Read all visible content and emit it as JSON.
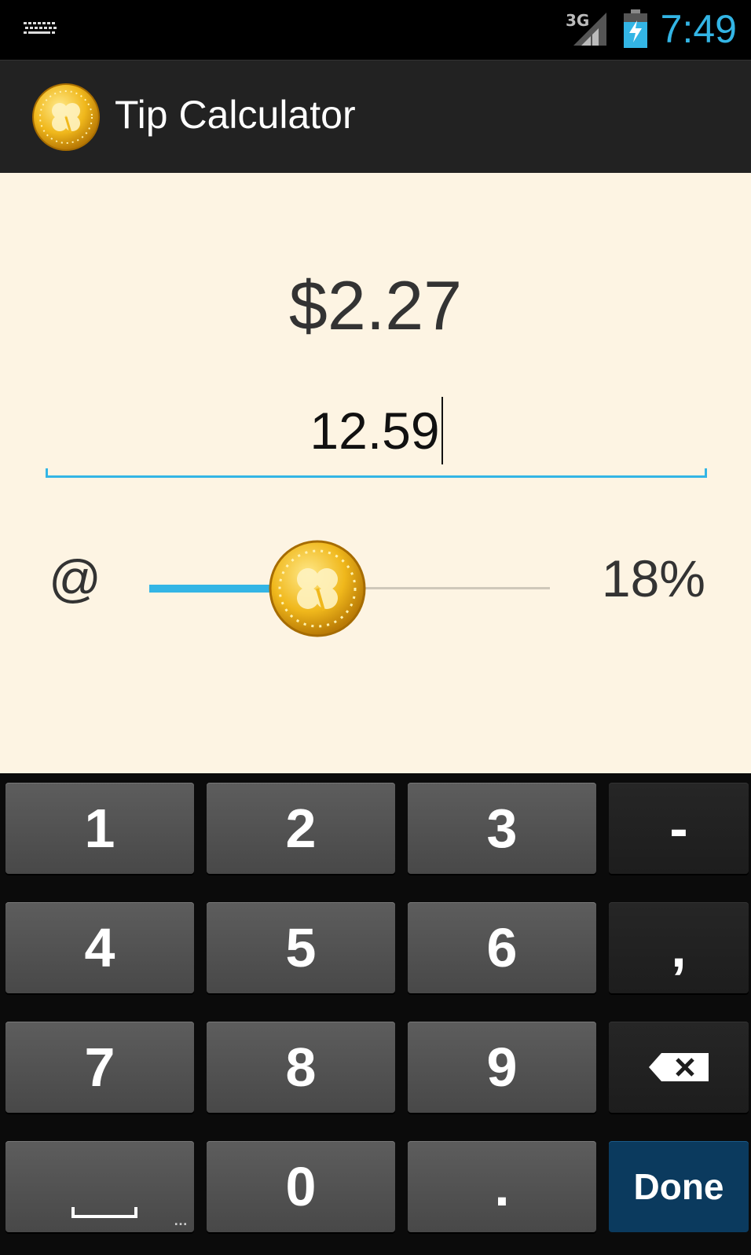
{
  "status_bar": {
    "network": "3G",
    "time": "7:49"
  },
  "action_bar": {
    "title": "Tip Calculator",
    "icon": "coin-clover-icon"
  },
  "main": {
    "tip_amount": "$2.27",
    "bill_amount": "12.59",
    "at_label": "@",
    "tip_percent_label": "18%",
    "slider_fraction": 0.42
  },
  "keypad": {
    "rows": [
      [
        "1",
        "2",
        "3",
        "-"
      ],
      [
        "4",
        "5",
        "6",
        ","
      ],
      [
        "7",
        "8",
        "9",
        "backspace"
      ],
      [
        "space",
        "0",
        ".",
        "Done"
      ]
    ],
    "done_label": "Done"
  },
  "colors": {
    "accent": "#33b5e5",
    "content_bg": "#fdf4e3",
    "action_bar_bg": "#222222",
    "done_key_bg": "#0b3a5e"
  }
}
